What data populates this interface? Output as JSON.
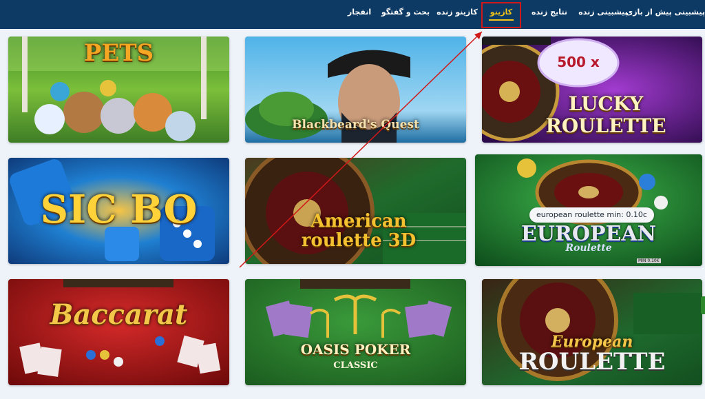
{
  "nav": {
    "items": [
      {
        "label": "پیشبینی پیش از بازی",
        "active": false
      },
      {
        "label": "پیشبینی زنده",
        "active": false
      },
      {
        "label": "نتایج زنده",
        "active": false
      },
      {
        "label": "کازینو",
        "active": true
      },
      {
        "label": "کازینو زنده",
        "active": false
      },
      {
        "label": "بحث و گفتگو",
        "active": false
      },
      {
        "label": "انفجار",
        "active": false
      }
    ]
  },
  "games": [
    {
      "title": "PETS",
      "subtitle": ""
    },
    {
      "title": "Blackbeard's Quest",
      "subtitle": ""
    },
    {
      "title": "LUCKY ROULETTE",
      "subtitle": "",
      "badge": "500 x"
    },
    {
      "title": "SIC BO",
      "subtitle": ""
    },
    {
      "title": "American roulette 3D",
      "subtitle": ""
    },
    {
      "title": "EUROPEAN",
      "subtitle": "Roulette",
      "tooltip": "european roulette min: 0.10c",
      "min_badge": "MIN 0.10€"
    },
    {
      "title": "Baccarat",
      "subtitle": ""
    },
    {
      "title": "OASIS POKER",
      "subtitle": "CLASSIC"
    },
    {
      "title": "European",
      "subtitle": "ROULETTE"
    }
  ],
  "colors": {
    "nav_bg": "#0d3a64",
    "active": "#f5c518",
    "page_bg": "#eef3f9",
    "annotation": "#d01818"
  }
}
